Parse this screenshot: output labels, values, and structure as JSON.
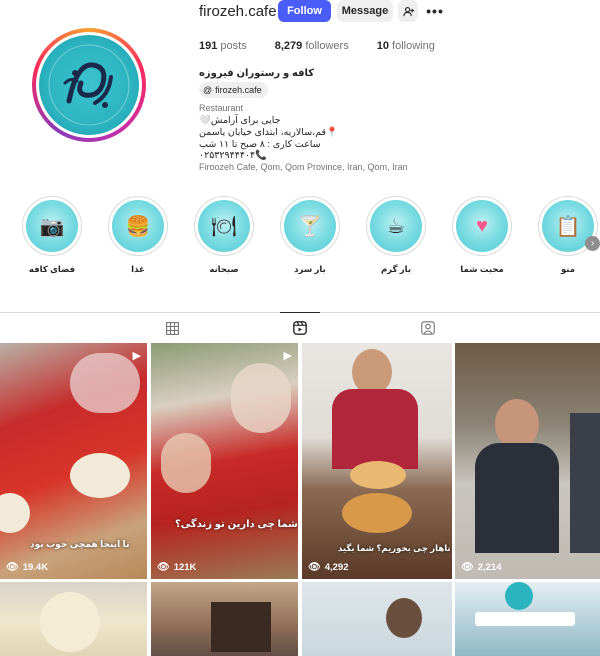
{
  "profile": {
    "username": "firozeh.cafe",
    "follow_label": "Follow",
    "message_label": "Message",
    "more_label": "•••",
    "posts_count": "191",
    "posts_label": "posts",
    "followers_count": "8,279",
    "followers_label": "followers",
    "following_count": "10",
    "following_label": "following",
    "display_name": "کافه و رستوران فیروزه",
    "threads_handle": "firozeh.cafe",
    "category": "Restaurant",
    "bio_lines": [
      "جایی برای آرامش🤍",
      "📍قم،سالاریه، ابتدای خیابان یاسمن",
      "ساعت کاری : ۸ صبح تا ۱۱ شب",
      "📞۰۲۵۳۲۹۴۴۴۰۴"
    ],
    "location": "Firoozeh Cafe, Qom, Qom Province, Iran, Qom, Iran"
  },
  "highlights": [
    {
      "label": "فضای کافه",
      "icon": "camera-icon"
    },
    {
      "label": "غذا",
      "icon": "burger-icon"
    },
    {
      "label": "صبحانه",
      "icon": "plate-icon"
    },
    {
      "label": "بار سرد",
      "icon": "cocktail-icon"
    },
    {
      "label": "بار گرم",
      "icon": "coffee-icon"
    },
    {
      "label": "محبت شما",
      "icon": "heart-icon"
    },
    {
      "label": "منو",
      "icon": "menu-icon"
    }
  ],
  "tabs": [
    {
      "name": "posts",
      "icon": "grid-icon"
    },
    {
      "name": "reels",
      "icon": "reels-icon",
      "active": true
    },
    {
      "name": "tagged",
      "icon": "tagged-icon"
    }
  ],
  "reels": [
    {
      "views": "19.4K",
      "caption": "تا اینجا همچی خوب بود"
    },
    {
      "views": "121K",
      "caption": "شما چی دارین تو زندگی؟"
    },
    {
      "views": "4,292",
      "caption": "ناهار چی بخوریم؟ شما بگید"
    },
    {
      "views": "2,214",
      "caption": ""
    },
    {
      "views": "",
      "caption": ""
    },
    {
      "views": "",
      "caption": ""
    },
    {
      "views": "",
      "caption": ""
    },
    {
      "views": "",
      "caption": ""
    }
  ],
  "colors": {
    "follow_button": "#4a5df9",
    "highlight_teal": "#4cc9d2",
    "muted_text": "#737373"
  }
}
